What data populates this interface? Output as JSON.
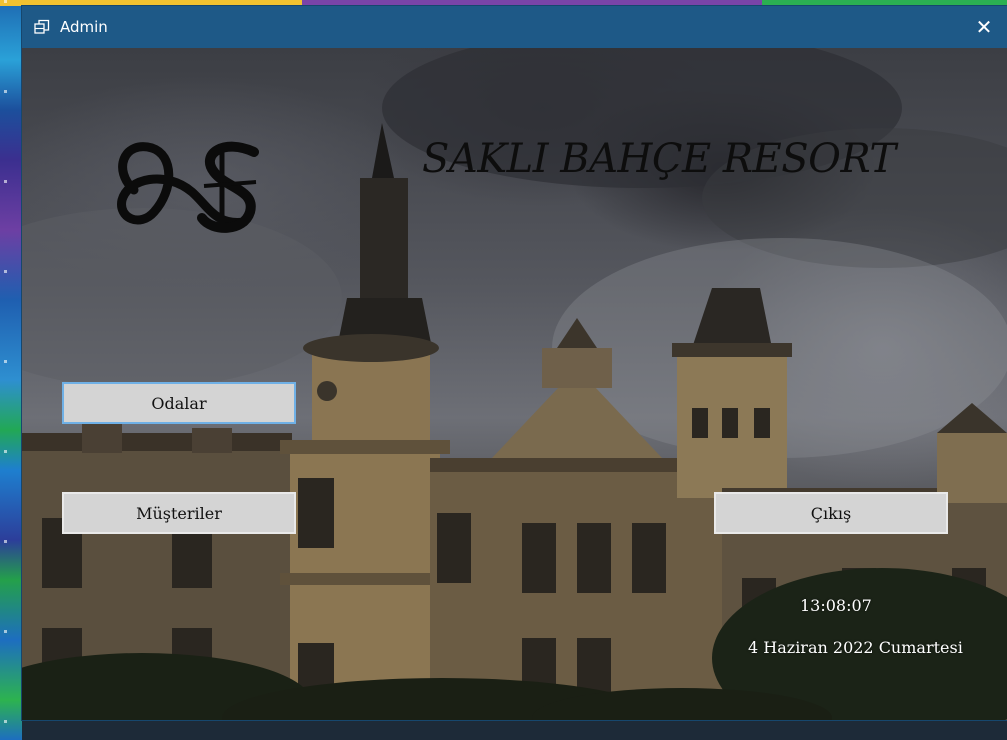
{
  "window": {
    "title": "Admin",
    "close_glyph": "✕",
    "icon": "window-restore-icon"
  },
  "brand": {
    "logo_alt": "SB monogram",
    "title": "SAKLI BAHÇE RESORT"
  },
  "buttons": {
    "rooms": "Odalar",
    "customers": "Müşteriler",
    "exit": "Çıkış"
  },
  "status": {
    "time": "13:08:07",
    "date": "4 Haziran 2022 Cumartesi"
  },
  "colors": {
    "titlebar": "#1e5987",
    "button_bg": "#d4d4d4",
    "button_focus_border": "#6fb0e6",
    "title_text": "#0d0d0d"
  }
}
